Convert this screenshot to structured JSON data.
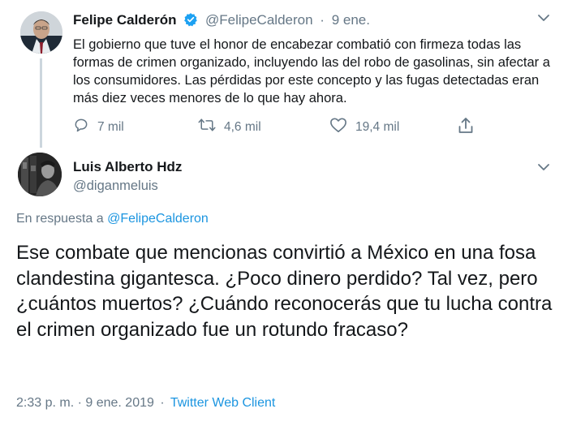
{
  "parent": {
    "display_name": "Felipe Calderón",
    "handle": "@FelipeCalderon",
    "separator": "·",
    "time": "9 ene.",
    "text": "El gobierno que tuve el honor de encabezar combatió con firmeza todas las formas de crimen organizado, incluyendo las del robo de gasolinas, sin afectar a los consumidores. Las pérdidas por este concepto y las fugas detectadas eran más diez veces menores de lo que hay ahora.",
    "replies": "7 mil",
    "retweets": "4,6 mil",
    "likes": "19,4 mil"
  },
  "reply": {
    "display_name": "Luis Alberto Hdz",
    "handle": "@diganmeluis",
    "in_reply_prefix": "En respuesta a",
    "in_reply_handle": "@FelipeCalderon",
    "text": "Ese combate que mencionas convirtió a México en una fosa clandestina gigantesca. ¿Poco dinero perdido? Tal vez, pero ¿cuántos muertos? ¿Cuándo reconocerás que tu lucha contra el crimen organizado fue un rotundo fracaso?",
    "timestamp": "2:33 p. m. · 9 ene. 2019",
    "separator": "·",
    "client": "Twitter Web Client"
  },
  "icons": {
    "verified": "verified-badge-icon",
    "chevron": "chevron-down-icon",
    "reply": "reply-icon",
    "retweet": "retweet-icon",
    "like": "heart-icon",
    "share": "share-icon"
  },
  "colors": {
    "link": "#1b95e0",
    "secondary_text": "#657786",
    "thread_line": "#ccd6dd"
  }
}
